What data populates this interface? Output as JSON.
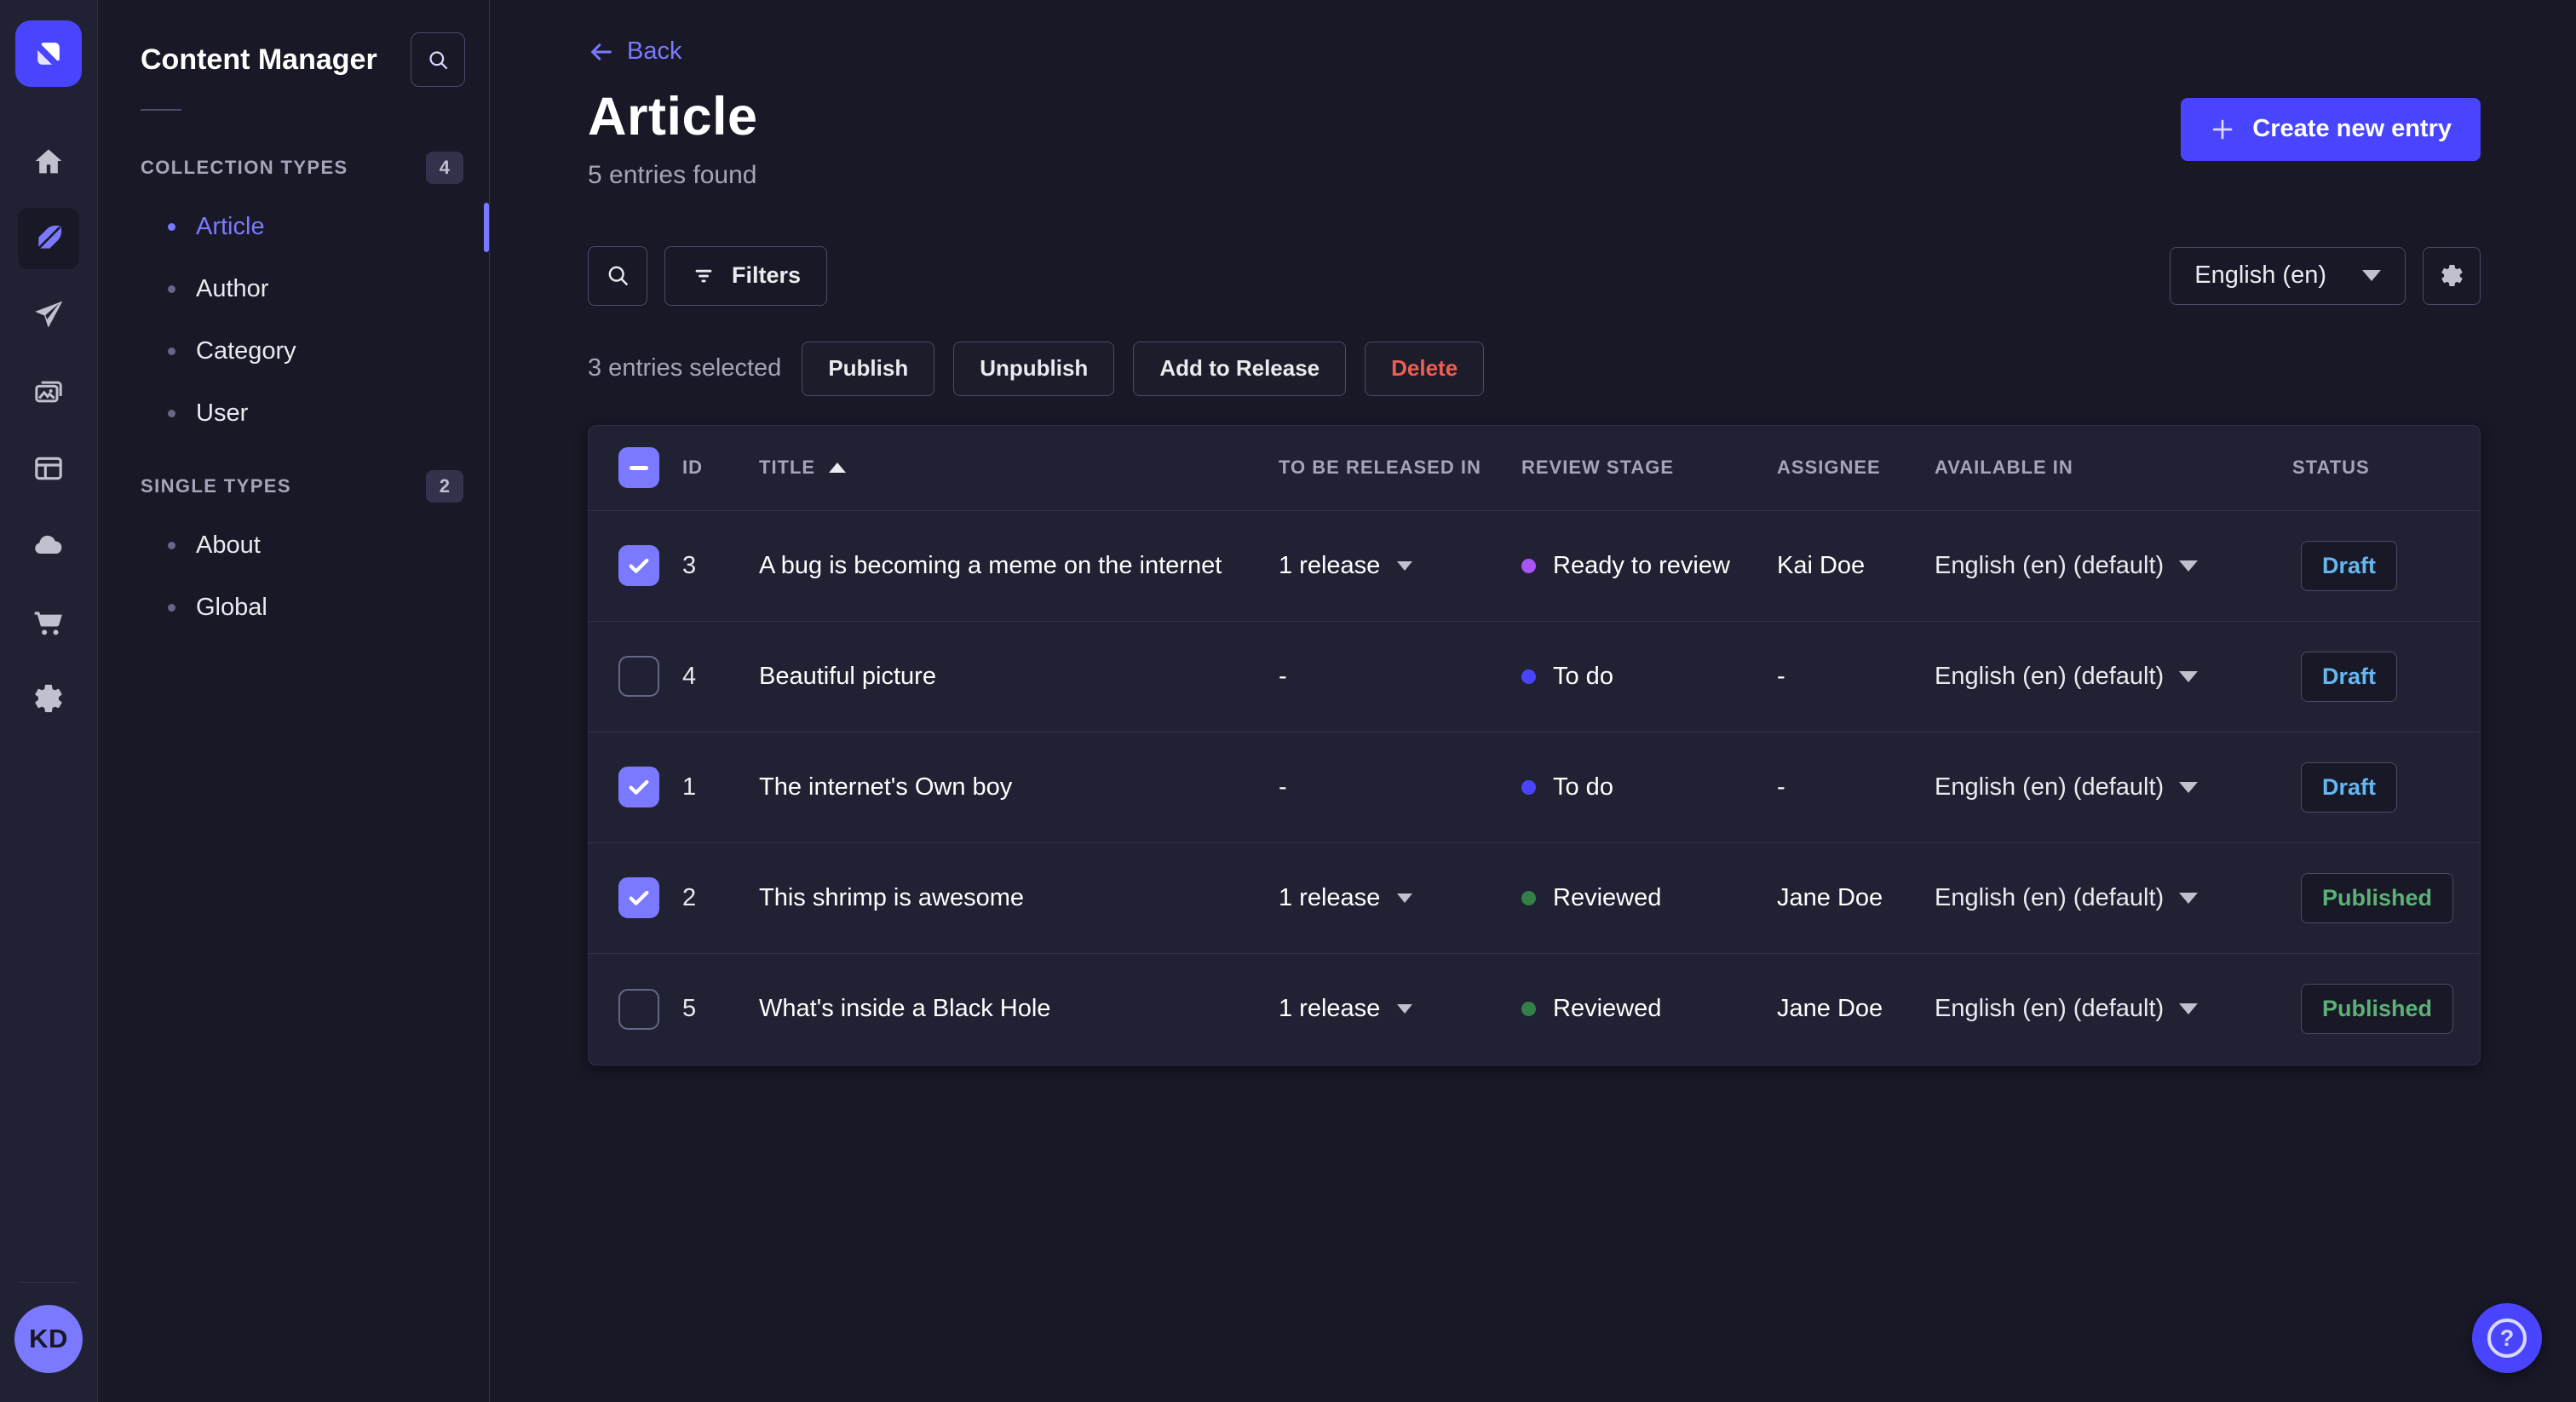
{
  "colors": {
    "background": "#181826",
    "surface": "#212134",
    "primary": "#4945ff",
    "primary_light": "#7b79ff",
    "border": "#32324d",
    "border_light": "#4a4a6a",
    "text_muted": "#a5a5ba",
    "danger": "#ee5e52",
    "success": "#5cb176",
    "info": "#66b7f1"
  },
  "rail": {
    "icons": [
      "home-icon",
      "content-manager-icon",
      "releases-icon",
      "media-library-icon",
      "content-type-builder-icon",
      "deploy-icon",
      "marketplace-icon",
      "settings-icon"
    ],
    "active_icon": "content-manager-icon",
    "avatar_initials": "KD"
  },
  "subnav": {
    "title": "Content Manager",
    "sections": [
      {
        "label": "COLLECTION TYPES",
        "badge": "4",
        "items": [
          {
            "label": "Article",
            "active": true
          },
          {
            "label": "Author",
            "active": false
          },
          {
            "label": "Category",
            "active": false
          },
          {
            "label": "User",
            "active": false
          }
        ]
      },
      {
        "label": "SINGLE TYPES",
        "badge": "2",
        "items": [
          {
            "label": "About",
            "active": false
          },
          {
            "label": "Global",
            "active": false
          }
        ]
      }
    ]
  },
  "header": {
    "back_label": "Back",
    "title": "Article",
    "subtitle": "5 entries found",
    "create_button": "Create new entry"
  },
  "toolbar": {
    "filters_label": "Filters",
    "locale": "English (en)"
  },
  "selection": {
    "text": "3 entries selected",
    "publish": "Publish",
    "unpublish": "Unpublish",
    "add_to_release": "Add to Release",
    "delete": "Delete"
  },
  "table": {
    "headers": {
      "id": "ID",
      "title": "TITLE",
      "released": "TO BE RELEASED IN",
      "review": "REVIEW STAGE",
      "assignee": "ASSIGNEE",
      "available": "AVAILABLE IN",
      "status": "STATUS"
    },
    "sort": {
      "column": "TITLE",
      "direction": "asc"
    },
    "rows": [
      {
        "checked": true,
        "id": "3",
        "title": "A bug is becoming a meme on the internet",
        "released": "1 release",
        "review": "Ready to review",
        "review_color": "#a855f7",
        "assignee": "Kai Doe",
        "available": "English (en) (default)",
        "status": "Draft",
        "status_color": "#66b7f1"
      },
      {
        "checked": false,
        "id": "4",
        "title": "Beautiful picture",
        "released": "-",
        "review": "To do",
        "review_color": "#4945ff",
        "assignee": "-",
        "available": "English (en) (default)",
        "status": "Draft",
        "status_color": "#66b7f1"
      },
      {
        "checked": true,
        "id": "1",
        "title": "The internet's Own boy",
        "released": "-",
        "review": "To do",
        "review_color": "#4945ff",
        "assignee": "-",
        "available": "English (en) (default)",
        "status": "Draft",
        "status_color": "#66b7f1"
      },
      {
        "checked": true,
        "id": "2",
        "title": "This shrimp is awesome",
        "released": "1 release",
        "review": "Reviewed",
        "review_color": "#328048",
        "assignee": "Jane Doe",
        "available": "English (en) (default)",
        "status": "Published",
        "status_color": "#5cb176"
      },
      {
        "checked": false,
        "id": "5",
        "title": "What's inside a Black Hole",
        "released": "1 release",
        "review": "Reviewed",
        "review_color": "#328048",
        "assignee": "Jane Doe",
        "available": "English (en) (default)",
        "status": "Published",
        "status_color": "#5cb176"
      }
    ]
  },
  "help": {
    "label": "?"
  }
}
